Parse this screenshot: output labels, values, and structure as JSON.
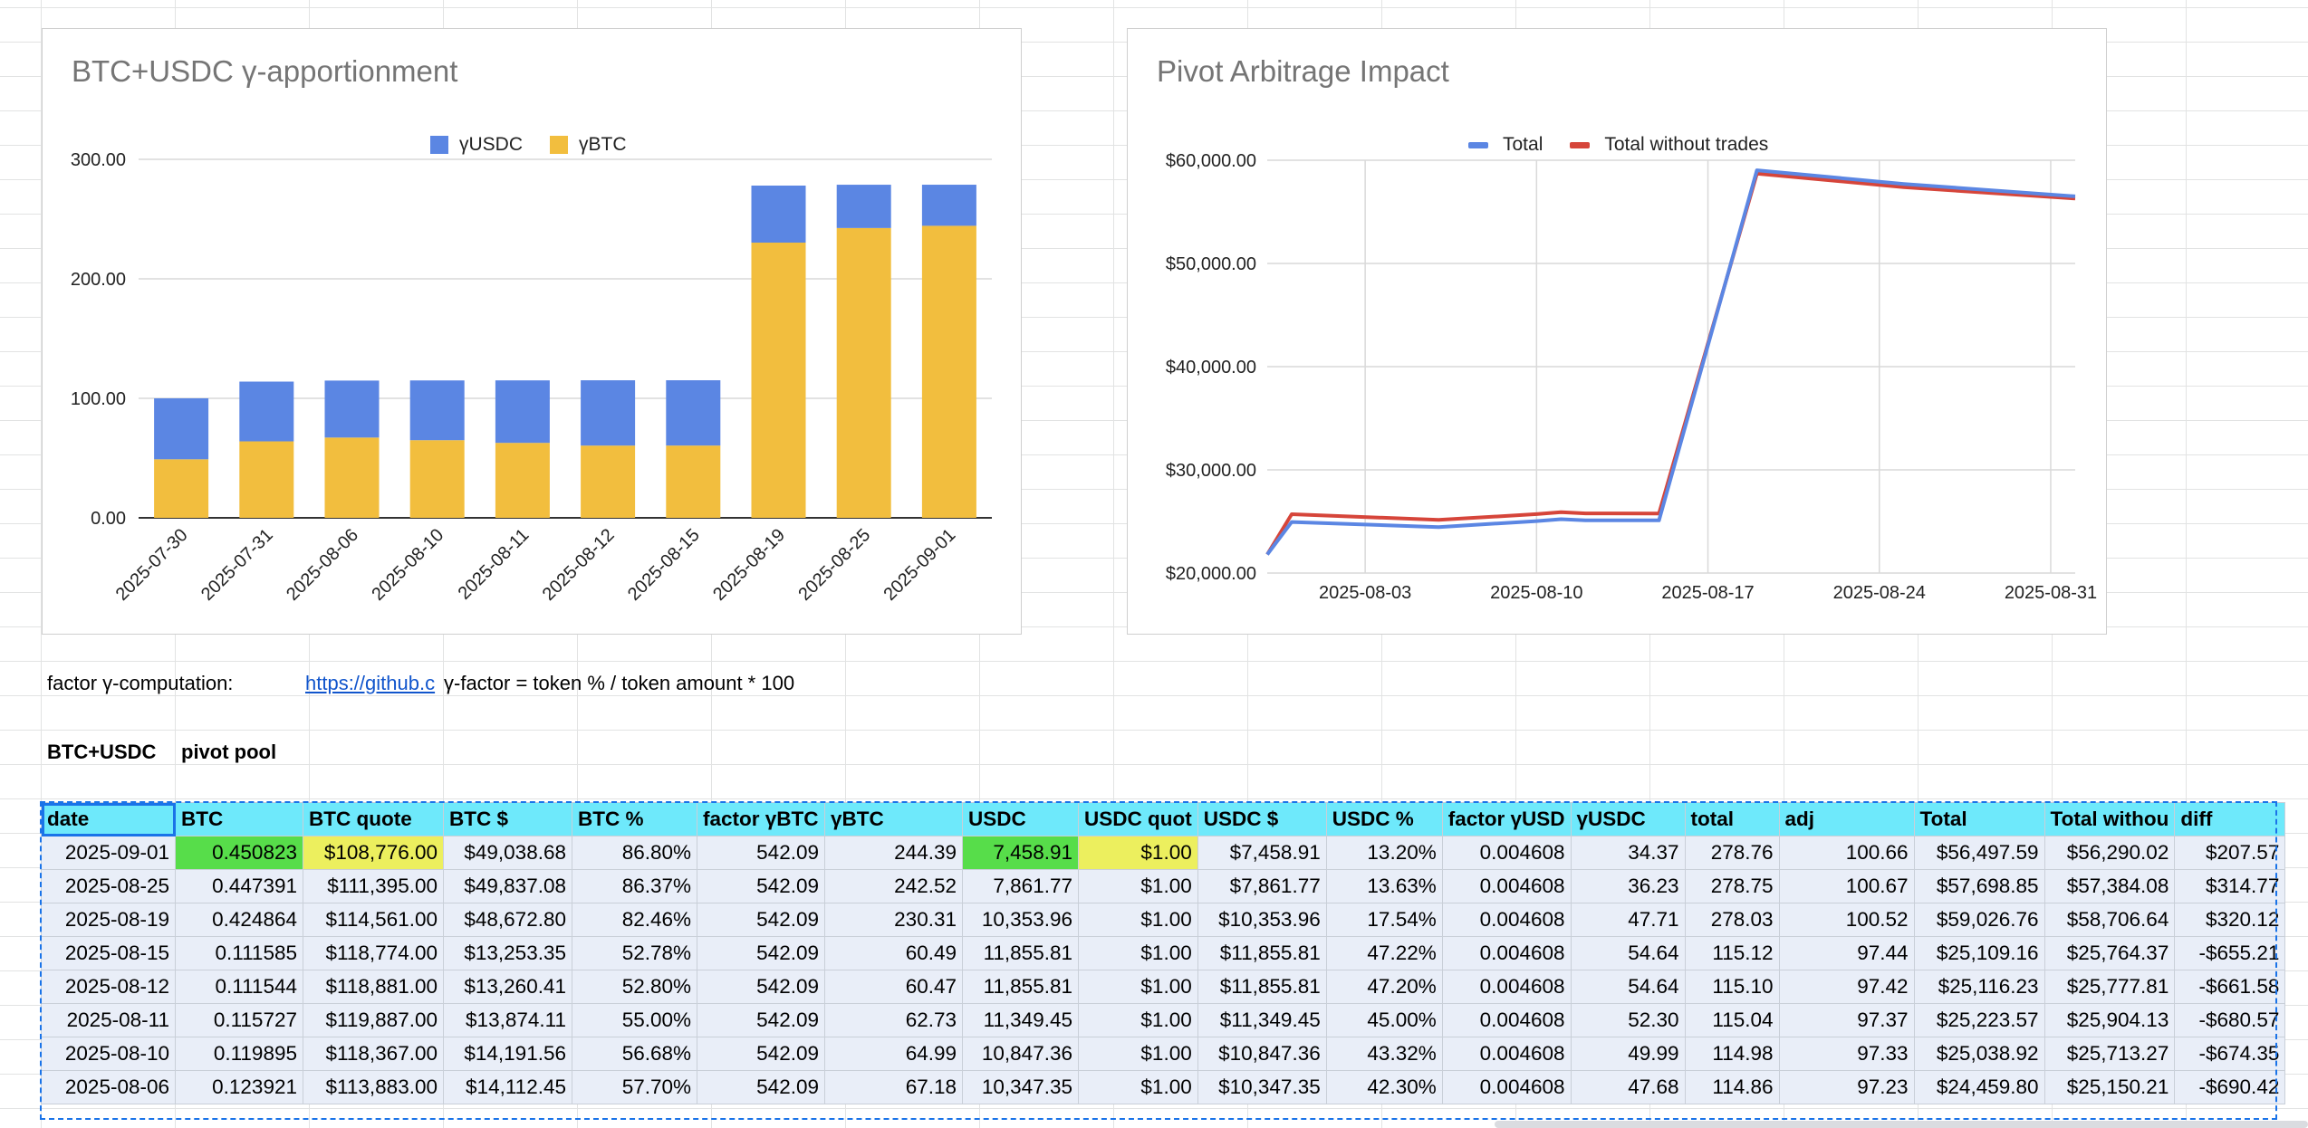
{
  "charts": {
    "apportionment": {
      "title": "BTC+USDC γ-apportionment",
      "legend": [
        {
          "label": "γUSDC",
          "color": "#5b86e3"
        },
        {
          "label": "γBTC",
          "color": "#f2be3e"
        }
      ]
    },
    "arbitrage": {
      "title": "Pivot Arbitrage Impact",
      "legend": [
        {
          "label": "Total",
          "color": "#5b86e3"
        },
        {
          "label": "Total without trades",
          "color": "#d6453a"
        }
      ]
    }
  },
  "chart_data": [
    {
      "type": "bar",
      "stacked": true,
      "title": "BTC+USDC γ-apportionment",
      "categories": [
        "2025-07-30",
        "2025-07-31",
        "2025-08-06",
        "2025-08-10",
        "2025-08-11",
        "2025-08-12",
        "2025-08-15",
        "2025-08-19",
        "2025-08-25",
        "2025-09-01"
      ],
      "series": [
        {
          "name": "γBTC",
          "color": "#f2be3e",
          "values": [
            49,
            64,
            67.18,
            64.99,
            62.73,
            60.47,
            60.49,
            230.31,
            242.52,
            244.39
          ]
        },
        {
          "name": "γUSDC",
          "color": "#5b86e3",
          "values": [
            51,
            50,
            47.68,
            49.99,
            52.3,
            54.64,
            54.64,
            47.71,
            36.23,
            34.37
          ]
        }
      ],
      "ylim": [
        0,
        300
      ],
      "yticks": [
        "0.00",
        "100.00",
        "200.00",
        "300.00"
      ],
      "legend_position": "top",
      "grid": true
    },
    {
      "type": "line",
      "title": "Pivot Arbitrage Impact",
      "x_ticks": [
        "2025-08-03",
        "2025-08-10",
        "2025-08-17",
        "2025-08-24",
        "2025-08-31"
      ],
      "y_ticks": [
        "$20,000.00",
        "$30,000.00",
        "$40,000.00",
        "$50,000.00",
        "$60,000.00"
      ],
      "ylim": [
        20000,
        60000
      ],
      "xlim": [
        "2025-07-30",
        "2025-09-01"
      ],
      "series": [
        {
          "name": "Total",
          "color": "#5b86e3",
          "x": [
            "2025-07-30",
            "2025-07-31",
            "2025-08-06",
            "2025-08-10",
            "2025-08-11",
            "2025-08-12",
            "2025-08-15",
            "2025-08-19",
            "2025-08-25",
            "2025-09-01"
          ],
          "y": [
            21800,
            24950,
            24459.8,
            25038.92,
            25223.57,
            25116.23,
            25109.16,
            59026.76,
            57698.85,
            56497.59
          ]
        },
        {
          "name": "Total without trades",
          "color": "#d6453a",
          "x": [
            "2025-07-30",
            "2025-07-31",
            "2025-08-06",
            "2025-08-10",
            "2025-08-11",
            "2025-08-12",
            "2025-08-15",
            "2025-08-19",
            "2025-08-25",
            "2025-09-01"
          ],
          "y": [
            21800,
            25700,
            25150.21,
            25713.27,
            25904.13,
            25777.81,
            25764.37,
            58706.64,
            57384.08,
            56290.02
          ]
        }
      ],
      "legend_position": "top",
      "grid": true
    }
  ],
  "notes": {
    "factor_label": "factor γ-computation:",
    "link_text": "https://github.c",
    "formula": "γ-factor = token % / token amount * 100"
  },
  "section": {
    "label": "BTC+USDC",
    "sublabel": "pivot pool"
  },
  "table": {
    "headers": [
      "date",
      "BTC",
      "BTC quote",
      "BTC $",
      "BTC %",
      "factor γBTC",
      "γBTC",
      "USDC",
      "USDC quot",
      "USDC $",
      "USDC %",
      "factor γUSD",
      "γUSDC",
      "total",
      "adj",
      "Total",
      "Total withou",
      "diff"
    ],
    "rows": [
      [
        "2025-09-01",
        "0.450823",
        "$108,776.00",
        "$49,038.68",
        "86.80%",
        "542.09",
        "244.39",
        "7,458.91",
        "$1.00",
        "$7,458.91",
        "13.20%",
        "0.004608",
        "34.37",
        "278.76",
        "100.66",
        "$56,497.59",
        "$56,290.02",
        "$207.57"
      ],
      [
        "2025-08-25",
        "0.447391",
        "$111,395.00",
        "$49,837.08",
        "86.37%",
        "542.09",
        "242.52",
        "7,861.77",
        "$1.00",
        "$7,861.77",
        "13.63%",
        "0.004608",
        "36.23",
        "278.75",
        "100.67",
        "$57,698.85",
        "$57,384.08",
        "$314.77"
      ],
      [
        "2025-08-19",
        "0.424864",
        "$114,561.00",
        "$48,672.80",
        "82.46%",
        "542.09",
        "230.31",
        "10,353.96",
        "$1.00",
        "$10,353.96",
        "17.54%",
        "0.004608",
        "47.71",
        "278.03",
        "100.52",
        "$59,026.76",
        "$58,706.64",
        "$320.12"
      ],
      [
        "2025-08-15",
        "0.111585",
        "$118,774.00",
        "$13,253.35",
        "52.78%",
        "542.09",
        "60.49",
        "11,855.81",
        "$1.00",
        "$11,855.81",
        "47.22%",
        "0.004608",
        "54.64",
        "115.12",
        "97.44",
        "$25,109.16",
        "$25,764.37",
        "-$655.21"
      ],
      [
        "2025-08-12",
        "0.111544",
        "$118,881.00",
        "$13,260.41",
        "52.80%",
        "542.09",
        "60.47",
        "11,855.81",
        "$1.00",
        "$11,855.81",
        "47.20%",
        "0.004608",
        "54.64",
        "115.10",
        "97.42",
        "$25,116.23",
        "$25,777.81",
        "-$661.58"
      ],
      [
        "2025-08-11",
        "0.115727",
        "$119,887.00",
        "$13,874.11",
        "55.00%",
        "542.09",
        "62.73",
        "11,349.45",
        "$1.00",
        "$11,349.45",
        "45.00%",
        "0.004608",
        "52.30",
        "115.04",
        "97.37",
        "$25,223.57",
        "$25,904.13",
        "-$680.57"
      ],
      [
        "2025-08-10",
        "0.119895",
        "$118,367.00",
        "$14,191.56",
        "56.68%",
        "542.09",
        "64.99",
        "10,847.36",
        "$1.00",
        "$10,847.36",
        "43.32%",
        "0.004608",
        "49.99",
        "114.98",
        "97.33",
        "$25,038.92",
        "$25,713.27",
        "-$674.35"
      ],
      [
        "2025-08-06",
        "0.123921",
        "$113,883.00",
        "$14,112.45",
        "57.70%",
        "542.09",
        "67.18",
        "10,347.35",
        "$1.00",
        "$10,347.35",
        "42.30%",
        "0.004608",
        "47.68",
        "114.86",
        "97.23",
        "$24,459.80",
        "$25,150.21",
        "-$690.42"
      ]
    ],
    "highlight_colors": {
      "green": "#57dd4a",
      "yellow": "#ecef5e",
      "header": "#6ee9fb",
      "row": "#e9eef8"
    }
  }
}
